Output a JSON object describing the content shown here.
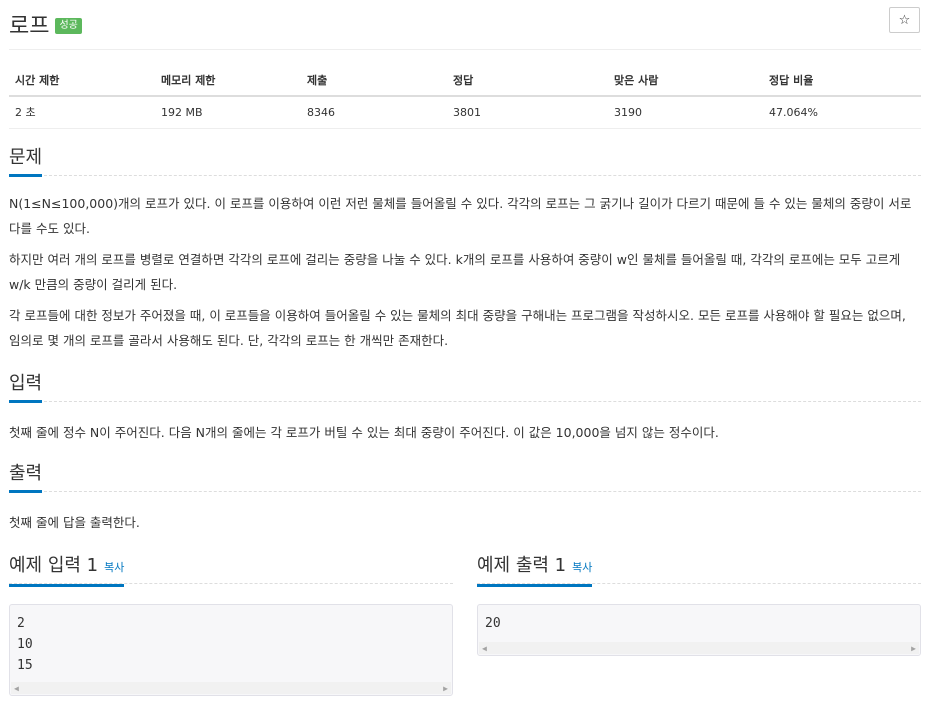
{
  "problem": {
    "title": "로프",
    "badge": "성공",
    "star_icon": "☆"
  },
  "info_table": {
    "headers": [
      "시간 제한",
      "메모리 제한",
      "제출",
      "정답",
      "맞은 사람",
      "정답 비율"
    ],
    "values": [
      "2 초",
      "192 MB",
      "8346",
      "3801",
      "3190",
      "47.064%"
    ]
  },
  "sections": {
    "problem": {
      "heading": "문제",
      "paragraphs": [
        "N(1≤N≤100,000)개의 로프가 있다. 이 로프를 이용하여 이런 저런 물체를 들어올릴 수 있다. 각각의 로프는 그 굵기나 길이가 다르기 때문에 들 수 있는 물체의 중량이 서로 다를 수도 있다.",
        "하지만 여러 개의 로프를 병렬로 연결하면 각각의 로프에 걸리는 중량을 나눌 수 있다. k개의 로프를 사용하여 중량이 w인 물체를 들어올릴 때, 각각의 로프에는 모두 고르게 w/k 만큼의 중량이 걸리게 된다.",
        "각 로프들에 대한 정보가 주어졌을 때, 이 로프들을 이용하여 들어올릴 수 있는 물체의 최대 중량을 구해내는 프로그램을 작성하시오. 모든 로프를 사용해야 할 필요는 없으며, 임의로 몇 개의 로프를 골라서 사용해도 된다. 단, 각각의 로프는 한 개씩만 존재한다."
      ]
    },
    "input": {
      "heading": "입력",
      "text": "첫째 줄에 정수 N이 주어진다. 다음 N개의 줄에는 각 로프가 버틸 수 있는 최대 중량이 주어진다. 이 값은 10,000을 넘지 않는 정수이다."
    },
    "output": {
      "heading": "출력",
      "text": "첫째 줄에 답을 출력한다."
    }
  },
  "examples": {
    "copy_label": "복사",
    "input": {
      "heading": "예제 입력 1",
      "lines": [
        "2",
        "10",
        "15"
      ]
    },
    "output": {
      "heading": "예제 출력 1",
      "lines": [
        "20"
      ]
    },
    "scroll_left_icon": "◀",
    "scroll_right_icon": "▶"
  }
}
